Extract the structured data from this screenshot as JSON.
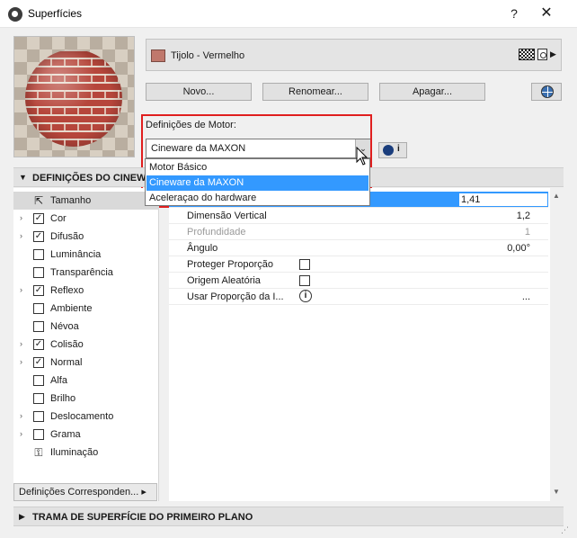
{
  "window": {
    "title": "Superfícies",
    "help": "?",
    "close": "✕"
  },
  "surface": {
    "name": "Tijolo - Vermelho",
    "swatch_color": "#c0786c",
    "arrow": "▶"
  },
  "buttons": {
    "new": "Novo...",
    "rename": "Renomear...",
    "delete": "Apagar..."
  },
  "engine": {
    "label": "Definições de Motor:",
    "selected": "Cineware da MAXON",
    "arrow": "⌄",
    "info": "i",
    "options": [
      "Motor Básico",
      "Cineware da MAXON",
      "Aceleraçao do hardware"
    ],
    "highlighted_index": 1
  },
  "section": {
    "title": "DEFINIÇÕES DO CINEWA",
    "toggle": "▼"
  },
  "channels": [
    {
      "label": "Tamanho",
      "expand": "",
      "type": "icon",
      "icon": "⇱",
      "checked": false,
      "active": true
    },
    {
      "label": "Cor",
      "expand": "›",
      "type": "checkbox",
      "checked": true
    },
    {
      "label": "Difusão",
      "expand": "›",
      "type": "checkbox",
      "checked": true
    },
    {
      "label": "Luminância",
      "expand": "",
      "type": "checkbox",
      "checked": false
    },
    {
      "label": "Transparência",
      "expand": "",
      "type": "checkbox",
      "checked": false
    },
    {
      "label": "Reflexo",
      "expand": "›",
      "type": "checkbox",
      "checked": true
    },
    {
      "label": "Ambiente",
      "expand": "",
      "type": "checkbox",
      "checked": false
    },
    {
      "label": "Névoa",
      "expand": "",
      "type": "checkbox",
      "checked": false
    },
    {
      "label": "Colisão",
      "expand": "›",
      "type": "checkbox",
      "checked": true
    },
    {
      "label": "Normal",
      "expand": "›",
      "type": "checkbox",
      "checked": true
    },
    {
      "label": "Alfa",
      "expand": "",
      "type": "checkbox",
      "checked": false
    },
    {
      "label": "Brilho",
      "expand": "",
      "type": "checkbox",
      "checked": false
    },
    {
      "label": "Deslocamento",
      "expand": "›",
      "type": "checkbox",
      "checked": false
    },
    {
      "label": "Grama",
      "expand": "›",
      "type": "checkbox",
      "checked": false
    },
    {
      "label": "Iluminação",
      "expand": "",
      "type": "icon",
      "icon": "⚿",
      "checked": false
    }
  ],
  "check_mark": "✓",
  "corresponding_button": "Definições Corresponden... ▸",
  "properties": {
    "width_value": "1,41",
    "vertical_label": "Dimensão Vertical",
    "vertical_value": "1,2",
    "depth_label": "Profundidade",
    "depth_value": "1",
    "angle_label": "Ângulo",
    "angle_value": "0,00°",
    "keep_ratio_label": "Proteger Proporção",
    "random_origin_label": "Origem Aleatória",
    "use_ratio_label": "Usar Proporção da I...",
    "use_ratio_info": "i",
    "use_ratio_value": "..."
  },
  "scroll": {
    "up": "▲",
    "down": "▼"
  },
  "bottom_section": {
    "title": "TRAMA DE SUPERFÍCIE DO PRIMEIRO PLANO",
    "toggle": "▶"
  },
  "resize_grip": "⋰"
}
